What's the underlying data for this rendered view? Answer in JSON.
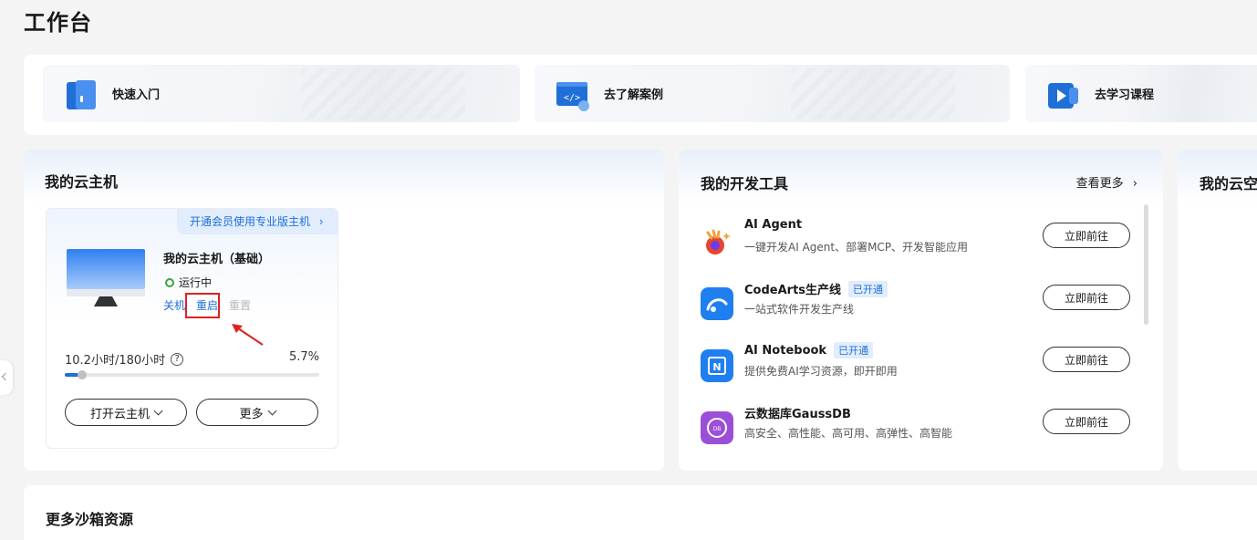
{
  "page": {
    "title": "工作台"
  },
  "quick_links": [
    {
      "label": "快速入门",
      "icon": "door-icon"
    },
    {
      "label": "去了解案例",
      "icon": "code-window-icon"
    },
    {
      "label": "去学习课程",
      "icon": "play-video-icon"
    }
  ],
  "cloud_host": {
    "section_title": "我的云主机",
    "promo": "开通会员使用专业版主机",
    "name": "我的云主机（基础）",
    "status": "运行中",
    "actions": {
      "shutdown": "关机",
      "restart": "重启",
      "reset": "重置"
    },
    "usage_text": "10.2小时/180小时",
    "usage_percent_label": "5.7%",
    "usage_fraction": 0.057,
    "open_button": "打开云主机",
    "more_button": "更多"
  },
  "dev_tools": {
    "section_title": "我的开发工具",
    "see_more": "查看更多",
    "items": [
      {
        "name": "AI Agent",
        "tag": "",
        "desc": "一键开发AI Agent、部署MCP、开发智能应用",
        "button": "立即前往",
        "icon": "ai-agent-icon"
      },
      {
        "name": "CodeArts生产线",
        "tag": "已开通",
        "desc": "一站式软件开发生产线",
        "button": "立即前往",
        "icon": "codearts-icon"
      },
      {
        "name": "AI Notebook",
        "tag": "已开通",
        "desc": "提供免费AI学习资源，即开即用",
        "button": "立即前往",
        "icon": "notebook-icon"
      },
      {
        "name": "云数据库GaussDB",
        "tag": "",
        "desc": "高安全、高性能、高可用、高弹性、高智能",
        "button": "立即前往",
        "icon": "gaussdb-icon"
      }
    ]
  },
  "cloud_space": {
    "section_title": "我的云空"
  },
  "more_resources": {
    "title": "更多沙箱资源"
  },
  "colors": {
    "accent": "#1f6fd6",
    "running": "#36a83c",
    "highlight": "#e02020"
  }
}
